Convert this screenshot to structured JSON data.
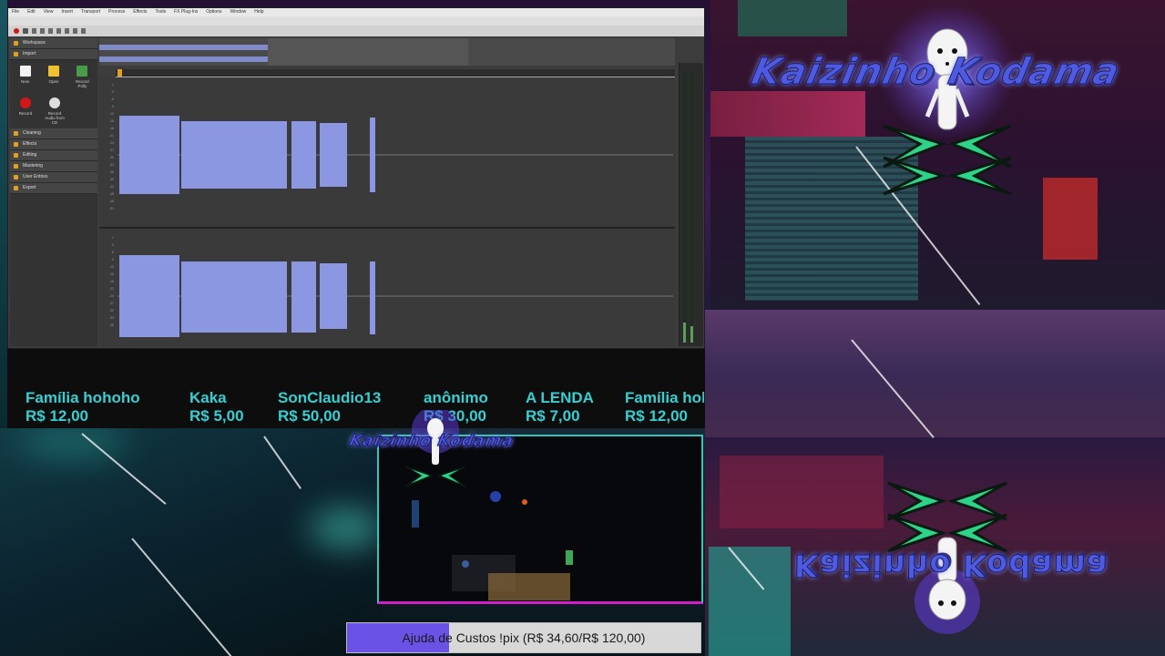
{
  "editor": {
    "menu": [
      "File",
      "Edit",
      "View",
      "Insert",
      "Transport",
      "Process",
      "Effects",
      "Tools",
      "FX Plug-Ins",
      "Options",
      "Window",
      "Help"
    ],
    "panel_sections_top": [
      "Workspace",
      "Import"
    ],
    "tools": [
      {
        "label": "New",
        "icon": "new-file-icon"
      },
      {
        "label": "Open",
        "icon": "open-folder-icon"
      },
      {
        "label": "Record Polly",
        "icon": "record-polly-icon"
      }
    ],
    "tools2": [
      {
        "label": "Record",
        "icon": "record-icon"
      },
      {
        "label": "Record Audio from CD",
        "icon": "cd-icon"
      }
    ],
    "panel_sections": [
      "Cleaning",
      "Effects",
      "Editing",
      "Mastering",
      "User Entries",
      "Export"
    ]
  },
  "donations": [
    {
      "name": "Família hohoho",
      "amount": "R$ 12,00"
    },
    {
      "name": "Kaka",
      "amount": "R$ 5,00"
    },
    {
      "name": "SonClaudio13",
      "amount": "R$ 50,00"
    },
    {
      "name": "anônimo",
      "amount": "R$ 30,00"
    },
    {
      "name": "A LENDA",
      "amount": "R$ 7,00"
    },
    {
      "name": "Família hohoho",
      "amount": "R$ 12,00"
    }
  ],
  "goal": {
    "label": "Ajuda de Custos !pix (R$ 34,60/R$ 120,00)",
    "current": 34.6,
    "target": 120.0
  },
  "logos": {
    "top": "Kaizinho Kodama",
    "cam": "Kaizinho Kodama",
    "bottom": "Kaizinho Kodama"
  },
  "colors": {
    "ticker_text": "#38cfd2",
    "goal_fill": "#6a52e6",
    "waveform": "#8b97e0",
    "cam_border_top": "#35c4b8",
    "cam_border_bottom": "#d21ec8"
  }
}
